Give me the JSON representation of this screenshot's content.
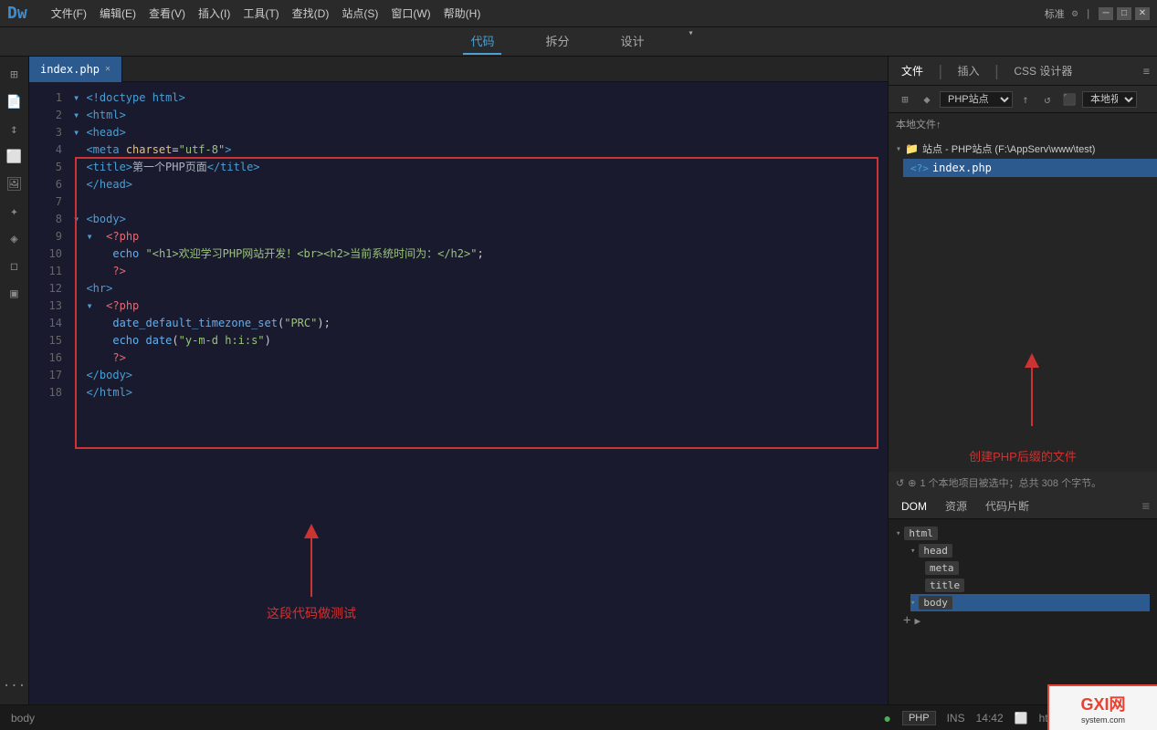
{
  "titlebar": {
    "logo": "Dw",
    "menus": [
      "文件(F)",
      "编辑(E)",
      "查看(V)",
      "插入(I)",
      "工具(T)",
      "查找(D)",
      "站点(S)",
      "窗口(W)",
      "帮助(H)"
    ],
    "mode": "标准",
    "settings_icon": "⚙",
    "minimize": "─",
    "maximize": "□",
    "close": "✕"
  },
  "view_tabs": {
    "code": "代码",
    "split": "拆分",
    "design": "设计",
    "dropdown": "▾"
  },
  "file_tab": {
    "name": "index.php",
    "close": "✕"
  },
  "code": {
    "lines": [
      "<!doctype html>",
      "<html>",
      "<head>",
      "  <meta charset=\"utf-8\">",
      "  <title>第一个PHP页面</title>",
      "</head>",
      "",
      "<body>",
      "  <?php",
      "    echo \"<h1>欢迎学习PHP网站开发！<br><h2>当前系统时间为：</h2>\";",
      "    ?>",
      "  <hr>",
      "  <?php",
      "    date_default_timezone_set(\"PRC\");",
      "    echo date(\"y-m-d h:i:s\")",
      "    ?>",
      "</body>",
      "</html>"
    ]
  },
  "annotations": {
    "left_arrow_label": "这段代码做测试",
    "right_arrow_label": "创建PHP后缀的文件"
  },
  "right_panel": {
    "tabs": [
      "文件",
      "插入",
      "CSS 设计器"
    ],
    "file_toolbar_icons": [
      "☷",
      "◆",
      "📁",
      "↑",
      "↺",
      "⬛"
    ],
    "site_name": "PHP站点",
    "view_name": "本地视图",
    "local_files_label": "本地文件↑",
    "site_label": "站点 - PHP站点 (F:\\AppServ\\www\\test)",
    "index_file": "index.php",
    "status_text": "1 个本地项目被选中；总共 308 个字节。"
  },
  "dom_panel": {
    "tabs": [
      "DOM",
      "资源",
      "代码片断"
    ],
    "tree": {
      "html": "html",
      "head": "head",
      "meta": "meta",
      "title": "title",
      "body": "body"
    }
  },
  "statusbar": {
    "element": "body",
    "green_dot": "●",
    "lang": "PHP",
    "mode": "INS",
    "time": "14:42",
    "url": "https://blog.csdn.net/q"
  },
  "watermark": {
    "text": "GXI网",
    "sub": "system.com"
  }
}
